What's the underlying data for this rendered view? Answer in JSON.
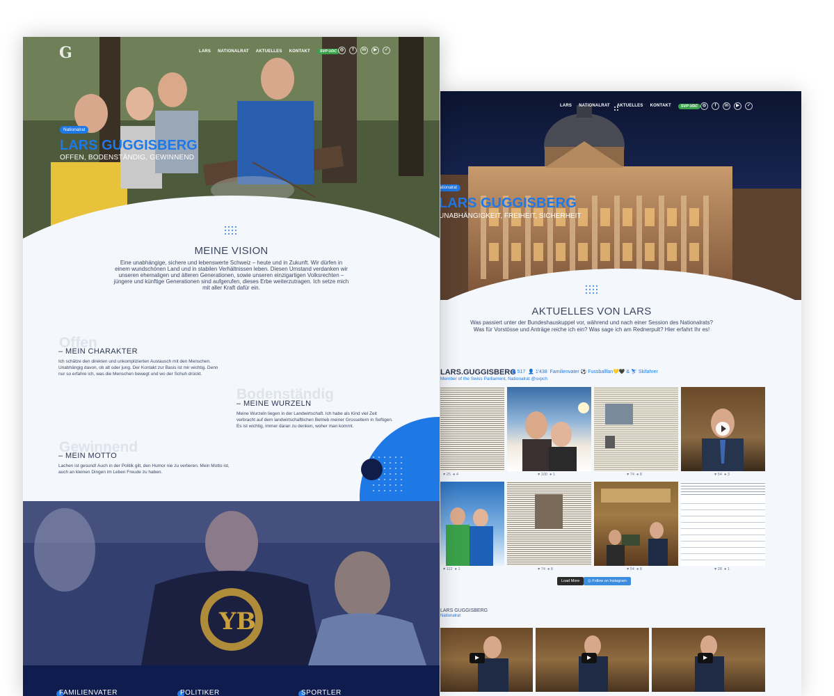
{
  "nav": {
    "items": [
      "LARS",
      "NATIONALRAT",
      "AKTUELLES",
      "KONTAKT"
    ],
    "party": "SVP UDC",
    "social_icons": [
      "instagram-icon",
      "facebook-icon",
      "linkedin-icon",
      "youtube-icon",
      "twitter-icon"
    ]
  },
  "front": {
    "logo": "G",
    "badge": "Nationalrat",
    "title": "LARS GUGGISBERG",
    "subtitle": "OFFEN, BODENSTÄNDIG, GEWINNEND",
    "vision": {
      "heading": "MEINE VISION",
      "text": "Eine unabhängige, sichere und lebenswerte Schweiz – heute und in Zukunft. Wir dürfen in einem wundschönen Land und in stabilen Verhältnissen leben. Diesen Umstand verdanken wir unseren ehemaligen und älteren Generationen, sowie unseren einzigartigen Volksrechten – jüngere und künftige Generationen sind aufgerufen, dieses Erbe weiterzutragen. Ich setze mich mit aller Kraft dafür ein."
    },
    "traits": [
      {
        "ghost": "Offen",
        "heading": "– MEIN CHARAKTER",
        "text": "Ich schätze den direkten und unkomplizierten Austausch mit den Menschen. Unabhängig davon, ob alt oder jung. Der Kontakt zur Basis ist mir wichtig. Denn nur so erfahre ich, was die Menschen bewegt und wo der Schuh drückt."
      },
      {
        "ghost": "Bodenständig",
        "heading": "– MEINE WURZELN",
        "text": "Meine Wurzeln liegen in der Landwirtschaft. Ich habe als Kind viel Zeit verbracht auf dem landwirtschaftlichen Betrieb meiner Grosseltern in Seftigen. Es ist wichtig, immer daran zu denken, woher man kommt."
      },
      {
        "ghost": "Gewinnend",
        "heading": "– MEIN MOTTO",
        "text": "Lachen ist gesund! Auch in der Politik gilt, den Humor nie zu verlieren. Mein Motto ist, auch an kleinen Dingen im Leben Freude zu haben."
      }
    ],
    "footer": [
      "FAMILIENVATER",
      "POLITIKER",
      "SPORTLER"
    ]
  },
  "back": {
    "badge": "Nationalrat",
    "title": "LARS GUGGISBERG",
    "subtitle": "UNABHÄNGIGKEIT, FREIHEIT, SICHERHEIT",
    "aktuelles": {
      "heading": "AKTUELLES VON LARS",
      "text_1": "Was passiert unter der Bundeshauskuppel vor, während und nach einer Session des Nationalrats?",
      "text_2": "Was für Vorstösse und Anträge reiche ich ein? Was sage ich am Rednerpult? Hier erfahrt Ihr es!"
    },
    "instagram": {
      "name": "LARS.GUGGISBERG",
      "posts": "517",
      "followers": "1'438",
      "extra": "Familienvater ⚽ Fussballfan💛🖤 & ⛷ Skifahrer",
      "bio": "Member of the Swiss Parliament, Nationalrat @svpch",
      "tiles": [
        {
          "likes": "25",
          "comments": "4",
          "kind": "news"
        },
        {
          "likes": "100",
          "comments": "1",
          "kind": "selfie"
        },
        {
          "likes": "74",
          "comments": "8",
          "kind": "paper"
        },
        {
          "likes": "54",
          "comments": "3",
          "kind": "video"
        },
        {
          "likes": "112",
          "comments": "1",
          "kind": "ski"
        },
        {
          "likes": "74",
          "comments": "8",
          "kind": "news2"
        },
        {
          "likes": "54",
          "comments": "8",
          "kind": "parliament"
        },
        {
          "likes": "28",
          "comments": "1",
          "kind": "form"
        }
      ],
      "load_more": "Load More",
      "follow": "Follow on Instagram"
    },
    "youtube": {
      "name": "LARS GUGGISBERG",
      "sub": "Nationalrat"
    }
  },
  "colors": {
    "accent": "#1e78e6",
    "navy": "#0f1d4e",
    "party_green": "#3aa14a"
  }
}
